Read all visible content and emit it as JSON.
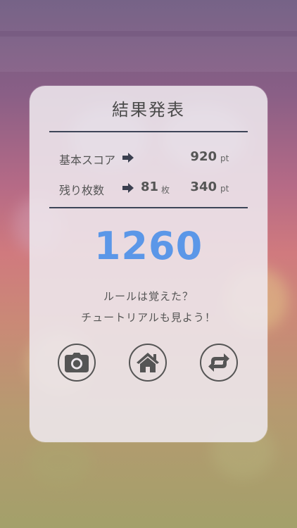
{
  "result": {
    "title": "結果発表",
    "base_score_label": "基本スコア",
    "base_score_value": "920",
    "remaining_label": "残り枚数",
    "remaining_count": "81",
    "remaining_count_unit": "枚",
    "remaining_score_value": "340",
    "pt_unit": "pt",
    "total": "1260",
    "message_line1": "ルールは覚えた？",
    "message_line2": "チュートリアルも見よう！"
  },
  "buttons": {
    "camera_icon": "camera-icon",
    "home_icon": "home-icon",
    "retry_icon": "retry-icon"
  },
  "colors": {
    "total": "#5b97e8",
    "rule": "#3d4558",
    "panel": "#eee8ee"
  }
}
